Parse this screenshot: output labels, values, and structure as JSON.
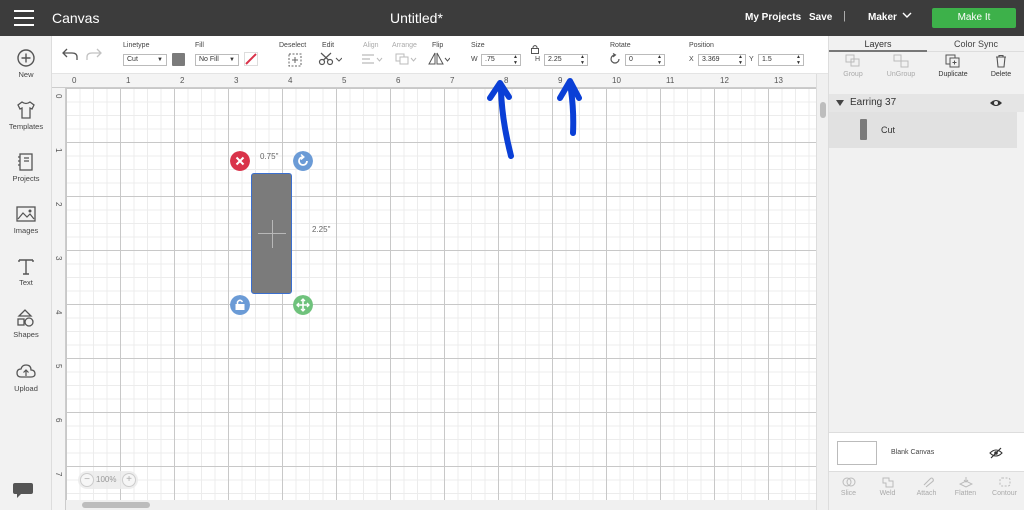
{
  "app": {
    "title": "Canvas",
    "document_title": "Untitled*",
    "my_projects": "My Projects",
    "save": "Save",
    "separator": "|",
    "machine": "Maker",
    "make_it": "Make It",
    "accent_color": "#3db14a",
    "topbar_color": "#3c3c3c"
  },
  "sidebar": {
    "items": [
      {
        "label": "New",
        "icon": "plus-circle-icon"
      },
      {
        "label": "Templates",
        "icon": "shirt-icon"
      },
      {
        "label": "Projects",
        "icon": "notebook-icon"
      },
      {
        "label": "Images",
        "icon": "image-icon"
      },
      {
        "label": "Text",
        "icon": "text-t-icon"
      },
      {
        "label": "Shapes",
        "icon": "shapes-icon"
      },
      {
        "label": "Upload",
        "icon": "cloud-upload-icon"
      }
    ],
    "chat_icon": "chat-bubble-icon"
  },
  "toolbar": {
    "linetype_label": "Linetype",
    "linetype_value": "Cut",
    "fill_label": "Fill",
    "fill_value": "No Fill",
    "deselect_label": "Deselect",
    "edit_label": "Edit",
    "align_label": "Align",
    "arrange_label": "Arrange",
    "flip_label": "Flip",
    "size_label": "Size",
    "size_w_axis": "W",
    "size_w_value": ".75",
    "size_h_axis": "H",
    "size_h_value": "2.25",
    "rotate_label": "Rotate",
    "rotate_value": "0",
    "position_label": "Position",
    "position_x_axis": "X",
    "position_x_value": "3.369",
    "position_y_axis": "Y",
    "position_y_value": "1.5",
    "swatch_color": "#7b7b7b"
  },
  "rulers": {
    "top": [
      "0",
      "1",
      "2",
      "3",
      "4",
      "5",
      "6",
      "7",
      "8",
      "9",
      "10",
      "11",
      "12",
      "13"
    ],
    "left": [
      "0",
      "1",
      "2",
      "3",
      "4",
      "5",
      "6",
      "7"
    ]
  },
  "canvas": {
    "width_label": "0.75\"",
    "height_label": "2.25\"",
    "zoom_value": "100%",
    "zoom_minus": "−",
    "zoom_plus": "+",
    "shape_color": "#7b7b7b",
    "selection_color": "#3a6fcf",
    "delete_handle_color": "#d9334a",
    "rotate_handle_color": "#6b9bd6",
    "lock_handle_color": "#6b9bd6",
    "resize_handle_color": "#6fc27c"
  },
  "layers_panel": {
    "tab_layers": "Layers",
    "tab_color_sync": "Color Sync",
    "actions": [
      {
        "label": "Group",
        "disabled": true
      },
      {
        "label": "UnGroup",
        "disabled": true
      },
      {
        "label": "Duplicate",
        "disabled": false
      },
      {
        "label": "Delete",
        "disabled": false
      }
    ],
    "group_name": "Earring 37",
    "layer_name": "Cut",
    "blank_canvas_label": "Blank Canvas",
    "bottom_actions": [
      "Slice",
      "Weld",
      "Attach",
      "Flatten",
      "Contour"
    ]
  },
  "annotation": {
    "arrow_color": "#0a3fd6"
  }
}
